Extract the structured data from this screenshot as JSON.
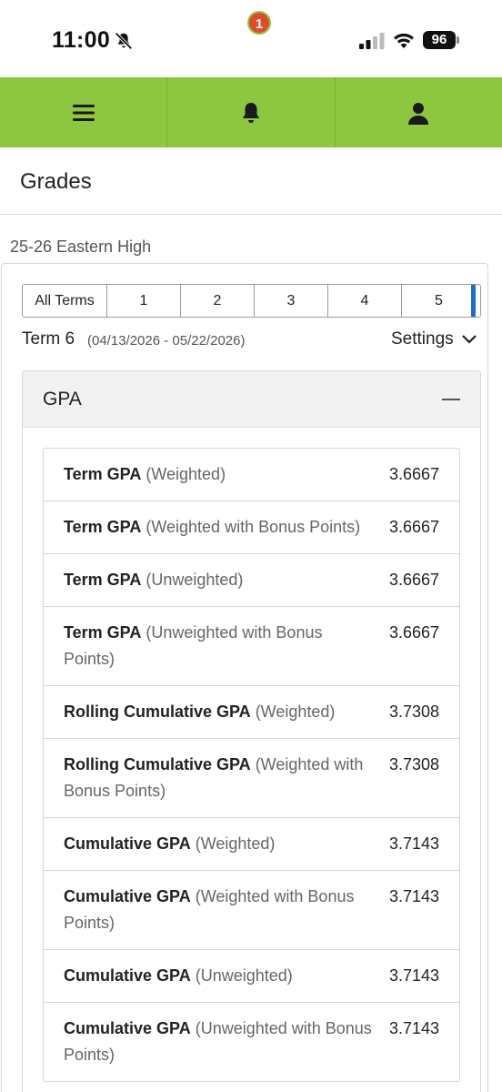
{
  "status_bar": {
    "time": "11:00",
    "battery": "96",
    "icons": [
      "bell-slash-icon",
      "cellular-signal-icon",
      "wifi-icon",
      "battery-icon"
    ]
  },
  "navbar": {
    "color": "#8dc63f",
    "items": [
      "menu-icon",
      "notifications-icon",
      "account-icon"
    ],
    "notification_count": "1"
  },
  "page": {
    "title": "Grades",
    "school": "25-26 Eastern High"
  },
  "terms": {
    "tabs": [
      "All Terms",
      "1",
      "2",
      "3",
      "4",
      "5"
    ],
    "current_name": "Term 6",
    "current_dates": "(04/13/2026 - 05/22/2026)",
    "settings_label": "Settings"
  },
  "gpa": {
    "title": "GPA",
    "rows": [
      {
        "name": "Term GPA",
        "qualifier": " (Weighted)",
        "value": "3.6667"
      },
      {
        "name": "Term GPA",
        "qualifier": " (Weighted with Bonus Points)",
        "value": "3.6667"
      },
      {
        "name": "Term GPA",
        "qualifier": " (Unweighted)",
        "value": "3.6667"
      },
      {
        "name": "Term GPA",
        "qualifier": " (Unweighted with Bonus Points)",
        "value": "3.6667"
      },
      {
        "name": "Rolling Cumulative GPA",
        "qualifier": " (Weighted)",
        "value": "3.7308"
      },
      {
        "name": "Rolling Cumulative GPA",
        "qualifier": " (Weighted with Bonus Points)",
        "value": "3.7308"
      },
      {
        "name": "Cumulative GPA",
        "qualifier": " (Weighted)",
        "value": "3.7143"
      },
      {
        "name": "Cumulative GPA",
        "qualifier": " (Weighted with Bonus Points)",
        "value": "3.7143"
      },
      {
        "name": "Cumulative GPA",
        "qualifier": " (Unweighted)",
        "value": "3.7143"
      },
      {
        "name": "Cumulative GPA",
        "qualifier": " (Unweighted with Bonus Points)",
        "value": "3.7143"
      }
    ]
  }
}
